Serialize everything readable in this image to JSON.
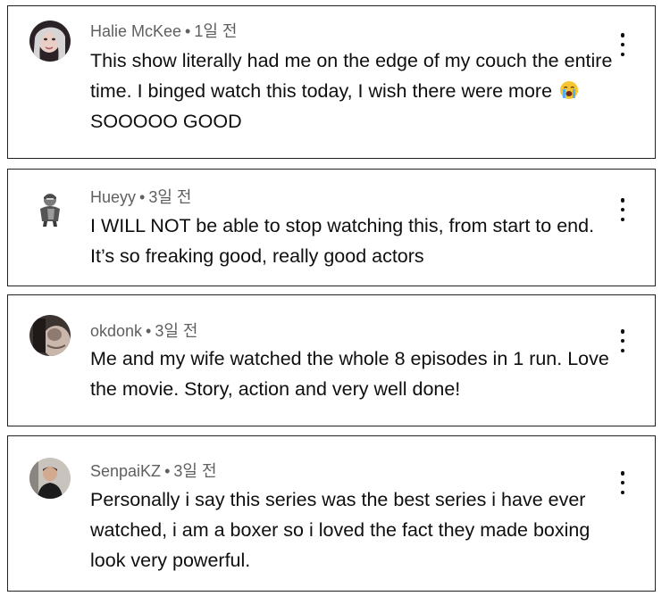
{
  "comments": [
    {
      "author": "Halie McKee",
      "time": "1일 전",
      "text_before_emoji": "This show literally had me on the edge of my couch the entire time. I binged watch this today, I wish there were more ",
      "emoji": "crying-face-emoji",
      "text_after_emoji": " SOOOOO GOOD"
    },
    {
      "author": "Hueyy",
      "time": "3일 전",
      "text": "I WILL NOT be able to stop watching this, from start to end. It’s so freaking good, really good actors"
    },
    {
      "author": "okdonk",
      "time": "3일 전",
      "text": "Me and my wife watched the whole 8 episodes in 1 run. Love the movie. Story, action and very well done!"
    },
    {
      "author": "SenpaiKZ",
      "time": "3일 전",
      "text": "Personally i say this series was the best series i have ever watched, i am a boxer so i loved the fact they made boxing look very powerful."
    }
  ],
  "separator": "•",
  "icons": {
    "menu": "more-vertical-icon"
  },
  "colors": {
    "meta_text": "#5f5f5f",
    "body_text": "#0f0f0f",
    "card_border": "#222222"
  }
}
